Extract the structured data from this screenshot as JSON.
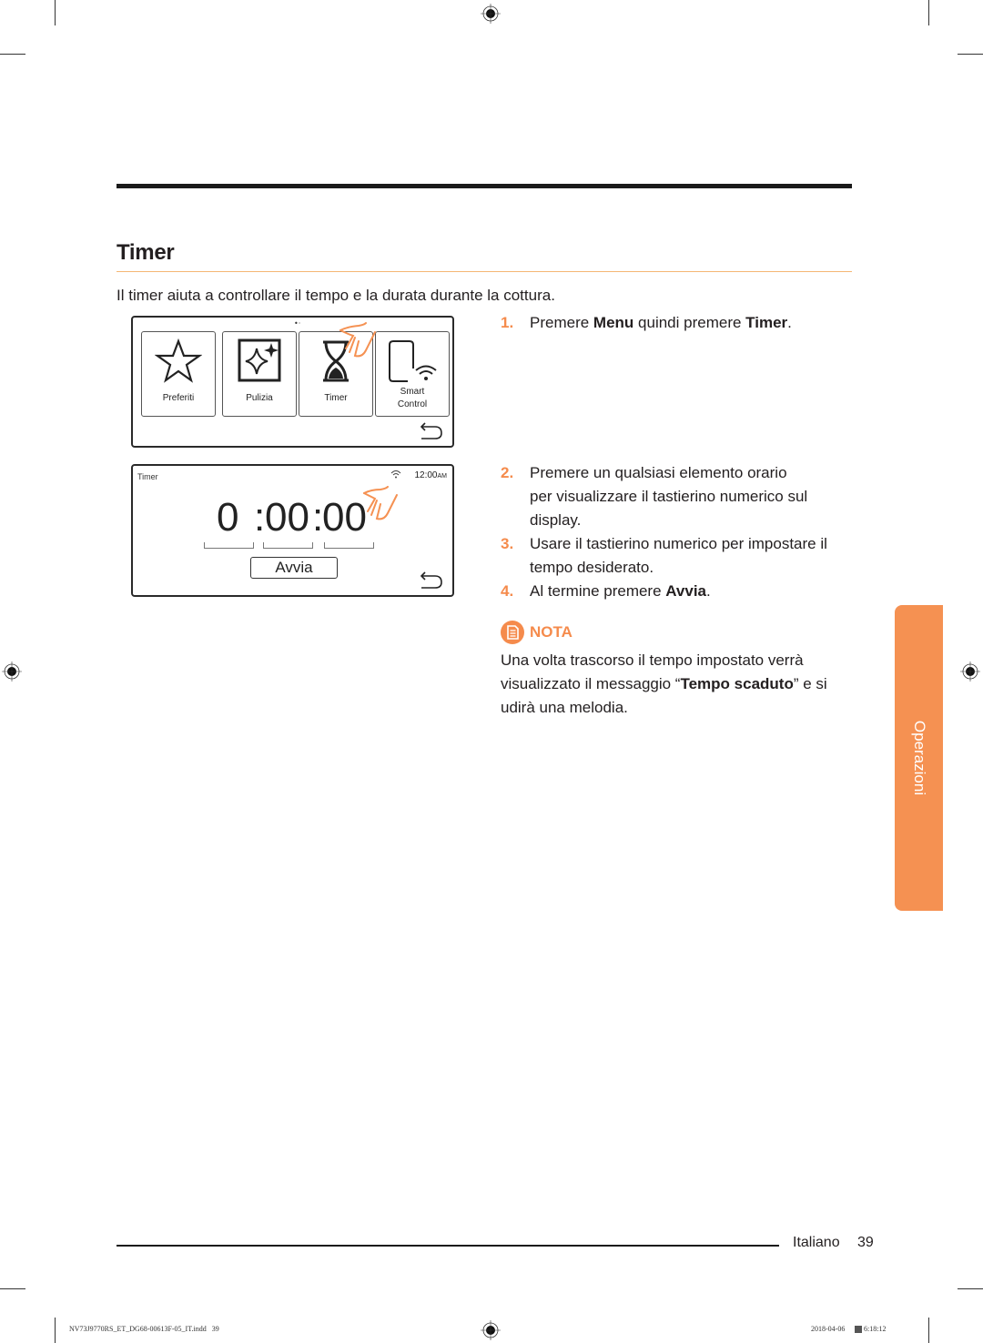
{
  "section": {
    "title": "Timer",
    "intro": "Il timer aiuta a controllare il tempo e la durata durante la cottura."
  },
  "screen_menu": {
    "tiles": [
      {
        "label": "Preferiti",
        "icon": "star-icon"
      },
      {
        "label": "Pulizia",
        "icon": "sparkle-icon"
      },
      {
        "label": "Timer",
        "icon": "hourglass-icon"
      },
      {
        "label_line1": "Smart",
        "label_line2": "Control",
        "icon": "phone-wifi-icon"
      }
    ],
    "page_indicator": "•·"
  },
  "screen_timer": {
    "title": "Timer",
    "clock": "12:00",
    "clock_suffix": "AM",
    "hours": "0",
    "minutes": "00",
    "seconds": "00",
    "sep": ":",
    "start_button": "Avvia"
  },
  "steps": [
    {
      "num": "1.",
      "pre": "Premere ",
      "b1": "Menu",
      "mid": " quindi premere ",
      "b2": "Timer",
      "post": "."
    },
    {
      "num": "2.",
      "line1": "Premere un qualsiasi elemento orario",
      "line2": "per visualizzare il tastierino numerico sul",
      "line3": "display."
    },
    {
      "num": "3.",
      "line1": "Usare il tastierino numerico per impostare il",
      "line2": "tempo desiderato."
    },
    {
      "num": "4.",
      "pre": "Al termine premere ",
      "b1": "Avvia",
      "post": "."
    }
  ],
  "note": {
    "heading": "NOTA",
    "line1": "Una volta trascorso il tempo impostato verrà",
    "line2_pre": "visualizzato il messaggio “",
    "line2_bold": "Tempo scaduto",
    "line2_post": "” e si",
    "line3": "udirà una melodia."
  },
  "side_tab": {
    "label": "Operazioni",
    "color": "#f59152"
  },
  "footer": {
    "language": "Italiano",
    "page": "39",
    "slug_file": "NV73J9770RS_ET_DG68-00613F-05_IT.indd   39",
    "slug_date": "2018-04-06",
    "slug_time": "6:18:12"
  },
  "colors": {
    "accent": "#f58b4c",
    "title_rule": "#f5b775",
    "text": "#231f20"
  }
}
